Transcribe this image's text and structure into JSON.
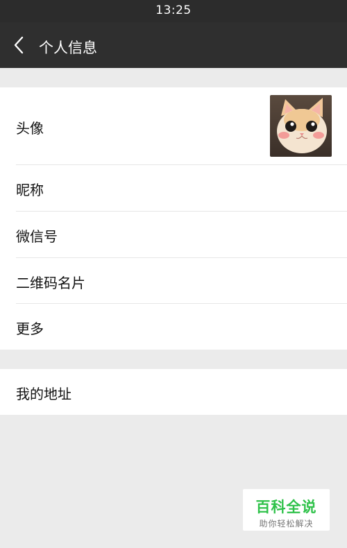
{
  "status_bar": {
    "time": "13:25",
    "left_text": "",
    "right_text": ""
  },
  "header": {
    "title": "个人信息",
    "back_icon": "chevron-left-icon"
  },
  "profile": {
    "avatar_label": "头像",
    "avatar_image": "cat-avatar",
    "items": [
      {
        "label": "昵称"
      },
      {
        "label": "微信号"
      },
      {
        "label": "二维码名片"
      },
      {
        "label": "更多"
      }
    ]
  },
  "address": {
    "label": "我的地址"
  },
  "watermark": {
    "title": "百科全说",
    "subtitle": "助你轻松解决"
  },
  "colors": {
    "header_bg": "#2f2f2f",
    "page_bg": "#ebebeb",
    "row_bg": "#ffffff",
    "watermark_green": "#2fc24a"
  }
}
